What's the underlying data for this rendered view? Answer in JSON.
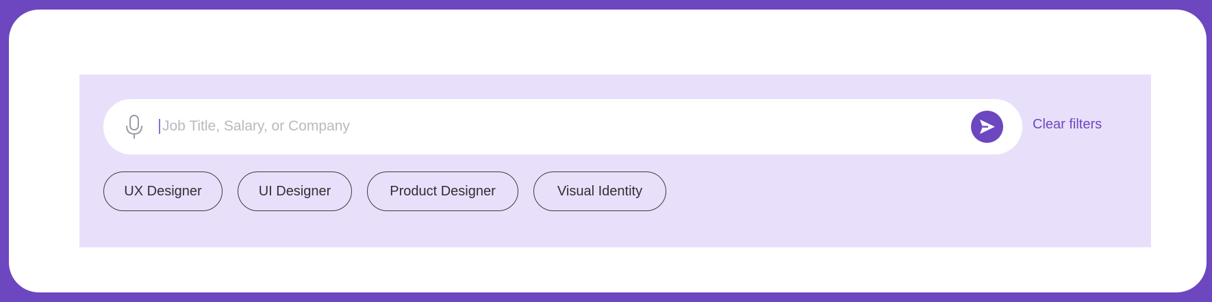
{
  "search": {
    "placeholder": "Job Title, Salary, or Company",
    "value": "",
    "mic_icon": "microphone-icon",
    "send_icon": "send-arrow-icon"
  },
  "clear_filters_label": "Clear filters",
  "chips": [
    {
      "label": "UX Designer"
    },
    {
      "label": "UI Designer"
    },
    {
      "label": "Product Designer"
    },
    {
      "label": "Visual Identity"
    }
  ],
  "colors": {
    "frame": "#6c47bf",
    "panel": "#e8e0fb",
    "accent": "#6c47bf",
    "placeholder": "#b9b9bf"
  }
}
